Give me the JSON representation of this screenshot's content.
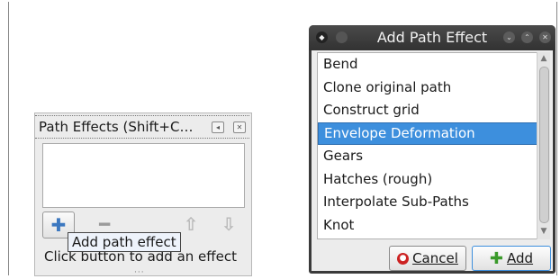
{
  "path_effects_panel": {
    "title": "Path Effects  (Shift+C…",
    "header_icons": [
      "restore-icon",
      "close-icon"
    ],
    "tools": [
      "add-icon",
      "remove-icon",
      "move-up-icon",
      "move-down-icon"
    ],
    "tooltip": "Add path effect",
    "hint": "Click button to add an effect"
  },
  "dialog": {
    "title": "Add Path Effect",
    "items": [
      "Bend",
      "Clone original path",
      "Construct grid",
      "Envelope Deformation",
      "Gears",
      "Hatches (rough)",
      "Interpolate Sub-Paths",
      "Knot"
    ],
    "selected_index": 3,
    "cancel_label": "Cancel",
    "add_label": "Add",
    "colors": {
      "selection": "#3d8fdd",
      "titlebar": "#3a3a3a"
    }
  }
}
